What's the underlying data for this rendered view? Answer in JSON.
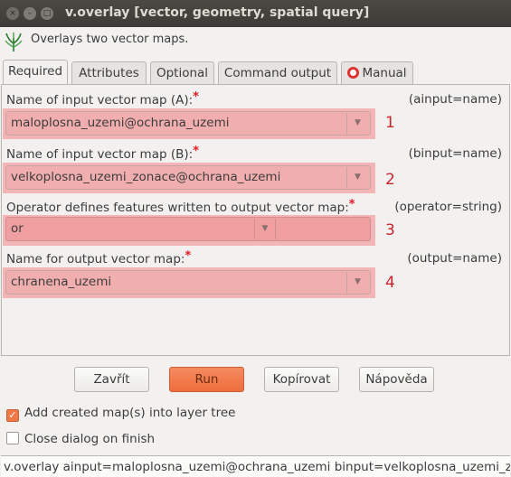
{
  "window": {
    "title": "v.overlay [vector, geometry, spatial query]",
    "close_glyph": "×",
    "minimize_glyph": "–",
    "maximize_glyph": "□"
  },
  "description": "Overlays two vector maps.",
  "tabs": [
    {
      "label": "Required",
      "active": true
    },
    {
      "label": "Attributes",
      "active": false
    },
    {
      "label": "Optional",
      "active": false
    },
    {
      "label": "Command output",
      "active": false
    },
    {
      "label": "Manual",
      "active": false
    }
  ],
  "fields": [
    {
      "label": "Name of input vector map (A):",
      "required_mark": "*",
      "key": "(ainput=name)",
      "value": "maloplosna_uzemi@ochrana_uzemi",
      "number": "1"
    },
    {
      "label": "Name of input vector map (B):",
      "required_mark": "*",
      "key": "(binput=name)",
      "value": "velkoplosna_uzemi_zonace@ochrana_uzemi",
      "number": "2"
    },
    {
      "label": "Operator defines features written to output vector map:",
      "required_mark": "*",
      "key": "(operator=string)",
      "value": "or",
      "number": "3"
    },
    {
      "label": "Name for output vector map:",
      "required_mark": "*",
      "key": "(output=name)",
      "value": "chranena_uzemi",
      "number": "4"
    }
  ],
  "dropdown_glyph": "▼",
  "buttons": {
    "close": "Zavřít",
    "run": "Run",
    "copy": "Kopírovat",
    "help": "Nápověda"
  },
  "options": {
    "add_to_layer_tree": {
      "label": "Add created map(s) into layer tree",
      "checked": true,
      "glyph": "✓"
    },
    "close_on_finish": {
      "label": "Close dialog on finish",
      "checked": false
    }
  },
  "command_line": "v.overlay ainput=maloplosna_uzemi@ochrana_uzemi binput=velkoplosna_uzemi_zonace@ochrana_uzemi operator=or output=chranena_uzemi",
  "colors": {
    "highlight": "#f2b1b1",
    "annotation_number": "#c6262e",
    "run_button": "#ee6e3d",
    "required_mark": "#e01b24"
  }
}
